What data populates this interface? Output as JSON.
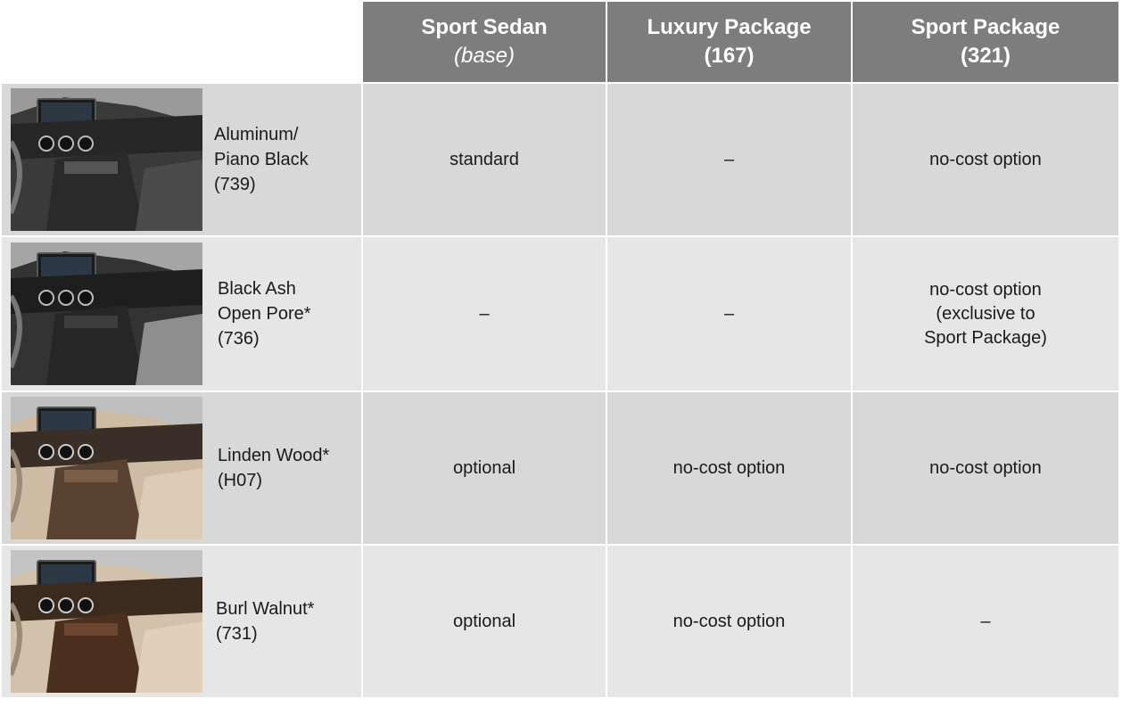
{
  "header": {
    "columns": [
      {
        "title": "Sport Sedan",
        "sub": "(base)"
      },
      {
        "title": "Luxury Package",
        "sub": "(167)"
      },
      {
        "title": "Sport Package",
        "sub": "(321)"
      }
    ]
  },
  "rows": [
    {
      "trim_lines": [
        "Aluminum/",
        "Piano Black",
        "(739)"
      ],
      "thumbnail": "dark-interior-aluminum-trim",
      "sport_sedan": "standard",
      "luxury": "–",
      "sport_pkg": [
        "no-cost option"
      ]
    },
    {
      "trim_lines": [
        "Black Ash",
        "Open Pore*",
        "(736)"
      ],
      "thumbnail": "dark-interior-black-ash-trim",
      "sport_sedan": "–",
      "luxury": "–",
      "sport_pkg": [
        "no-cost option",
        "(exclusive to",
        "Sport Package)"
      ]
    },
    {
      "trim_lines": [
        "Linden Wood*",
        "(H07)"
      ],
      "thumbnail": "beige-interior-linden-wood-trim",
      "sport_sedan": "optional",
      "luxury": "no-cost option",
      "sport_pkg": [
        "no-cost option"
      ]
    },
    {
      "trim_lines": [
        "Burl Walnut*",
        "(731)"
      ],
      "thumbnail": "beige-interior-burl-walnut-trim",
      "sport_sedan": "optional",
      "luxury": "no-cost option",
      "sport_pkg": [
        "–"
      ]
    }
  ],
  "colors": {
    "header_bg": "#7d7d7d",
    "row_dark": "#d8d8d8",
    "row_light": "#e6e6e6"
  }
}
